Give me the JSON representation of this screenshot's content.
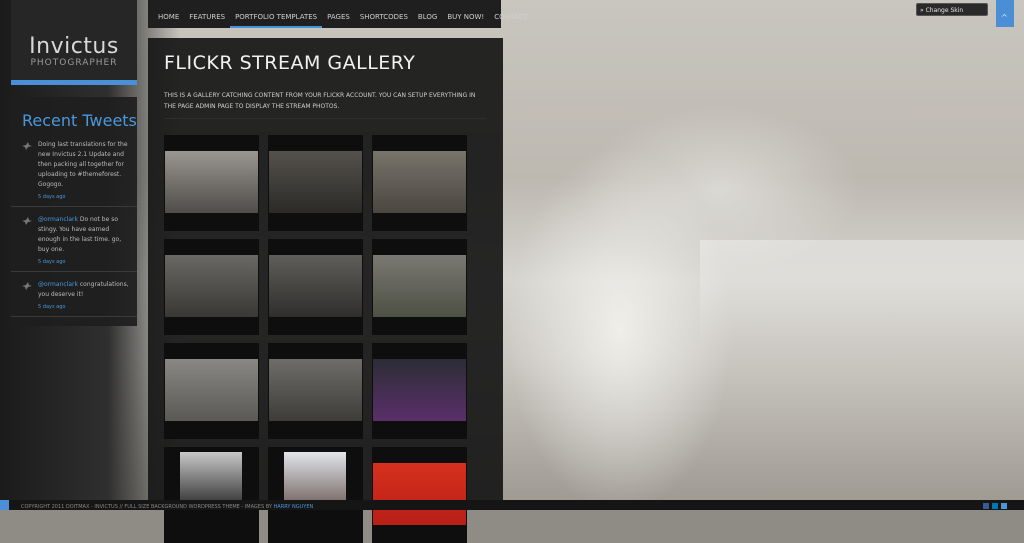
{
  "site": {
    "logo_name": "Invictus",
    "logo_sub": "PHOTOGRAPHER"
  },
  "nav": {
    "items": [
      "HOME",
      "FEATURES",
      "PORTFOLIO TEMPLATES",
      "PAGES",
      "SHORTCODES",
      "BLOG",
      "BUY NOW!",
      "CONTACT"
    ],
    "active": "PORTFOLIO TEMPLATES"
  },
  "tweets": {
    "heading": "Recent Tweets",
    "items": [
      {
        "handle": "",
        "text": "Doing last translations for the new Invictus 2.1 Update and then packing all together for uploading to #themeforest. Gogogo.",
        "time": "5 days ago"
      },
      {
        "handle": "@ormanclark",
        "text": " Do not be so stingy. You have earned enough in the last time. go, buy one.",
        "time": "5 days ago"
      },
      {
        "handle": "@ormanclark",
        "text": " congratulations, you deserve it!",
        "time": "5 days ago"
      }
    ]
  },
  "page": {
    "title": "FLICKR STREAM GALLERY",
    "description": "THIS IS A GALLERY CATCHING CONTENT FROM YOUR FLICKR ACCOUNT. YOU CAN SETUP EVERYTHING IN THE PAGE ADMIN PAGE TO DISPLAY THE STREAM PHOTOS."
  },
  "gallery": {
    "photos": [
      {
        "name": "shadow-on-pavement",
        "tones": [
          "#9a9690",
          "#4f4d4a"
        ]
      },
      {
        "name": "feet-dark-ground-leaf",
        "tones": [
          "#55524c",
          "#2b2a28"
        ]
      },
      {
        "name": "shadow-gravel-feet",
        "tones": [
          "#78746c",
          "#4a4740"
        ]
      },
      {
        "name": "feet-wet-road",
        "tones": [
          "#6a6864",
          "#3a3835"
        ]
      },
      {
        "name": "shadow-asphalt-line",
        "tones": [
          "#5f5e5b",
          "#2f2e2c"
        ]
      },
      {
        "name": "shadow-puddle-grass",
        "tones": [
          "#7a7872",
          "#4d5044"
        ]
      },
      {
        "name": "feet-sand",
        "tones": [
          "#8a8884",
          "#5b5955"
        ]
      },
      {
        "name": "feet-stone-shadow",
        "tones": [
          "#6f6d6a",
          "#3e3c39"
        ]
      },
      {
        "name": "hall-perspective",
        "tones": [
          "#2c2d36",
          "#5a2f6a"
        ]
      },
      {
        "name": "woman-window-bw",
        "tones": [
          "#c8c8c8",
          "#262626"
        ]
      },
      {
        "name": "girl-doorway-light",
        "tones": [
          "#e2e6ea",
          "#6c5a58"
        ]
      },
      {
        "name": "red-wall-tree",
        "tones": [
          "#d6301f",
          "#b81f14"
        ]
      }
    ]
  },
  "skin_switcher": {
    "label": "» Change Skin"
  },
  "back_to_top": {
    "icon": "chevron-up"
  },
  "footer": {
    "copyright": "COPYRIGHT 2011 DOITMAX - INVICTUS // FULL SIZE BACKGROUND WORDPRESS THEME - IMAGES BY ",
    "credit": "HARRY NGUYEN",
    "social": [
      "facebook-icon",
      "linkedin-icon",
      "twitter-icon"
    ]
  },
  "colors": {
    "accent": "#4a90d9",
    "link": "#4a98dc",
    "panel": "#1f1f1f"
  }
}
